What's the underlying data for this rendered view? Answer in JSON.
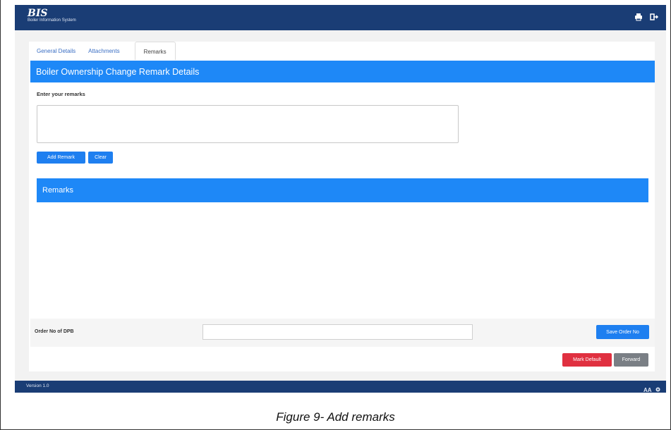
{
  "header": {
    "logo_text": "BIS",
    "logo_subtitle": "Boiler Information System",
    "icons": [
      "printer-icon",
      "logout-icon"
    ]
  },
  "tabs": [
    {
      "label": "General Details",
      "active": false
    },
    {
      "label": "Attachments",
      "active": false
    },
    {
      "label": "Remarks",
      "active": true
    }
  ],
  "panel": {
    "title": "Boiler Ownership Change Remark Details",
    "remarks_label": "Enter your remarks",
    "textarea_value": ""
  },
  "buttons": {
    "add_remark": "Add Remark",
    "clear": "Clear",
    "save_order": "Save Order No",
    "mark_default": "Mark Default",
    "forward": "Forward"
  },
  "remarks_section": {
    "title": "Remarks"
  },
  "order": {
    "label": "Order No of DPB",
    "value": ""
  },
  "footer": {
    "version": "Version 1.0",
    "icons": [
      "text-size-icon",
      "settings-icon"
    ]
  },
  "caption": "Figure 9- Add remarks",
  "colors": {
    "topbar": "#1a3d75",
    "panel_header": "#1e88f7",
    "primary_button": "#1e7ff0",
    "danger_button": "#e03040",
    "secondary_button": "#7a7f85"
  }
}
